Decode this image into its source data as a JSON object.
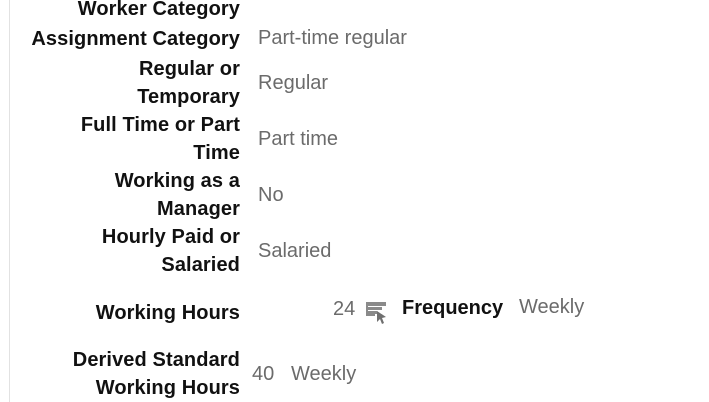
{
  "fields": {
    "worker_category": {
      "label": "Worker Category",
      "value": ""
    },
    "assignment_category": {
      "label": "Assignment Category",
      "value": "Part-time regular"
    },
    "regular_or_temporary": {
      "label_line1": "Regular or",
      "label_line2": "Temporary",
      "value": "Regular"
    },
    "full_time_or_part_time": {
      "label_line1": "Full Time or Part",
      "label_line2": "Time",
      "value": "Part time"
    },
    "working_as_manager": {
      "label_line1": "Working as a",
      "label_line2": "Manager",
      "value": "No"
    },
    "hourly_paid_or_salaried": {
      "label_line1": "Hourly Paid or",
      "label_line2": "Salaried",
      "value": "Salaried"
    },
    "working_hours": {
      "label": "Working Hours",
      "value": "24",
      "icon": "schedule-lookup-icon",
      "frequency_label": "Frequency",
      "frequency_value": "Weekly"
    },
    "derived_standard_working_hours": {
      "label_line1": "Derived Standard",
      "label_line2": "Working Hours",
      "value": "40",
      "frequency_value": "Weekly"
    }
  },
  "colors": {
    "label": "#111111",
    "value": "#6b6b6b",
    "border": "#e2e2e2"
  }
}
